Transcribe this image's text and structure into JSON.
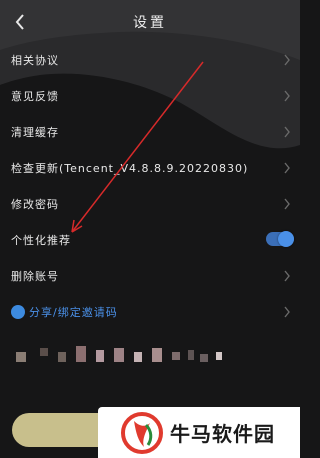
{
  "header": {
    "title": "设置",
    "back_icon": "chevron-left-icon"
  },
  "settings": {
    "items": [
      {
        "label": "相关协议"
      },
      {
        "label": "意见反馈"
      },
      {
        "label": "清理缓存"
      },
      {
        "label": "检查更新(Tencent_V4.8.8.9.20220830)"
      },
      {
        "label": "修改密码"
      },
      {
        "label": "个性化推荐",
        "toggle_on": true
      },
      {
        "label": "删除账号"
      },
      {
        "label": "分享/绑定邀请码"
      }
    ]
  },
  "colors": {
    "background": "#161617",
    "accent": "#4a90e8",
    "button": "#c8bf8c",
    "annotation_arrow": "#d62a2a"
  },
  "watermark": {
    "text": "牛马软件园"
  }
}
